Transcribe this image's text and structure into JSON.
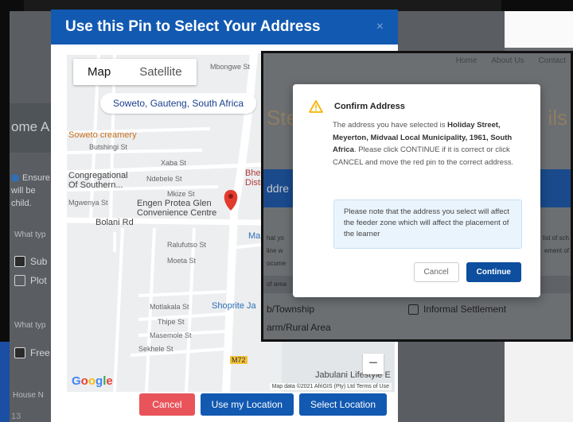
{
  "background": {
    "left_heading": "ome A",
    "info_text": "Ensure will be child.",
    "what_type_label_1": "What typ",
    "option_sub": "Sub",
    "option_plot": "Plot",
    "what_type_label_2": "What typ",
    "option_free": "Free",
    "house_label": "House N",
    "house_value": "13"
  },
  "pin_modal": {
    "title": "Use this Pin to Select Your Address",
    "close_label": "×",
    "map": {
      "tab_map": "Map",
      "tab_satellite": "Satellite",
      "search_value": "Soweto, Gauteng, South Africa",
      "poi_soweto_creamery": "Soweto creamery",
      "label_butshingi": "Butshingi St",
      "label_xaba": "Xaba St",
      "label_ndebele": "Ndebele St",
      "label_mkize": "Mkize St",
      "label_congregational": "Congregational Of Southern...",
      "label_mgwenya": "Mgwenya St",
      "label_engen": "Engen Protea Glen Convenience Centre",
      "label_bolani": "Bolani Rd",
      "label_ralufutso": "Ralufutso St",
      "label_moeta": "Moeta St",
      "label_shoprite": "Shoprite Ja",
      "label_motlakala": "Motlakala St",
      "label_thipe": "Thipe St",
      "label_masemole": "Masemole St",
      "label_sekhele": "Sekhele St",
      "label_mbongwe": "Mbongwe St",
      "label_bhe": "Bhe Distr",
      "label_ma": "Ma",
      "label_jabulani": "Jabulani Lifestyle E",
      "label_m72": "M72",
      "google_logo": "Google",
      "attribution": "Map data ©2021 AfriGIS (Pty) Ltd   Terms of Use",
      "zoom_out": "−"
    },
    "buttons": {
      "cancel": "Cancel",
      "use_location": "Use my Location",
      "select_location": "Select Location"
    }
  },
  "middle_page": {
    "nav_home": "Home",
    "nav_about": "About Us",
    "nav_contact": "Contact",
    "heading_left": "Ste",
    "heading_right": "ils",
    "section_label": "ddre",
    "text_1": "hat yo",
    "text_2": "line w",
    "text_3": "ocume",
    "text_r1": "list of sch",
    "text_r2": "ement of",
    "area_label": "of area",
    "opt_township": "b/Township",
    "opt_informal": "Informal Settlement",
    "opt_farm": "arm/Rural Area"
  },
  "confirm_dialog": {
    "title": "Confirm Address",
    "body_prefix": "The address you have selected is ",
    "address": "Holiday Street, Meyerton, Midvaal Local Municipality, 1961, South Africa",
    "body_suffix": ". Please click CONTINUE if it is correct or click CANCEL and move the red pin to the correct address.",
    "notice": "Please note that the address you select will affect the feeder zone which will affect the placement of the learner",
    "cancel": "Cancel",
    "continue": "Continue"
  },
  "colors": {
    "primary_blue": "#1259b1",
    "cancel_red": "#e8545a",
    "warning_yellow": "#f5b400",
    "notice_bg": "#eaf4fc"
  }
}
